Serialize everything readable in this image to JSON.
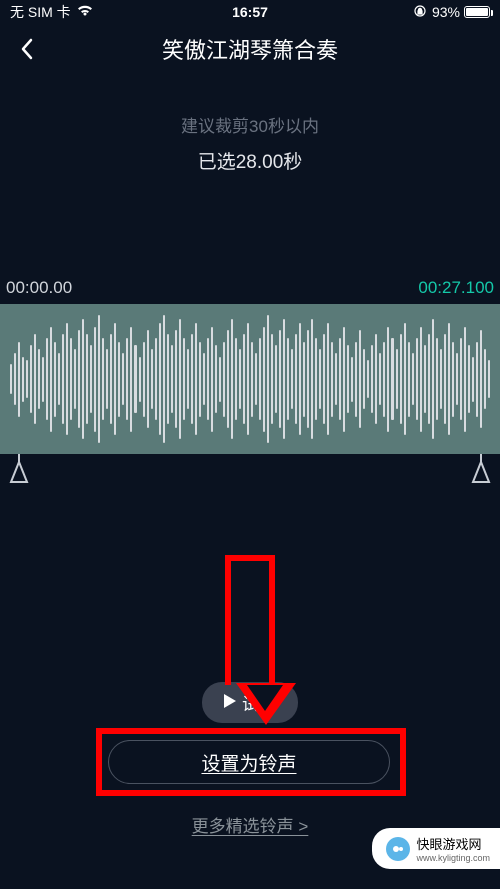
{
  "status": {
    "carrier": "无 SIM 卡",
    "time": "16:57",
    "battery_pct": "93%"
  },
  "header": {
    "title": "笑傲江湖琴箫合奏"
  },
  "info": {
    "hint": "建议裁剪30秒以内",
    "selected": "已选28.00秒"
  },
  "timeline": {
    "start": "00:00.00",
    "end": "00:27.100"
  },
  "buttons": {
    "preview": "试听",
    "set_ringtone": "设置为铃声",
    "more": "更多精选铃声 >"
  },
  "watermark": {
    "line1": "快眼游戏网",
    "line2": "www.kyligting.com"
  }
}
